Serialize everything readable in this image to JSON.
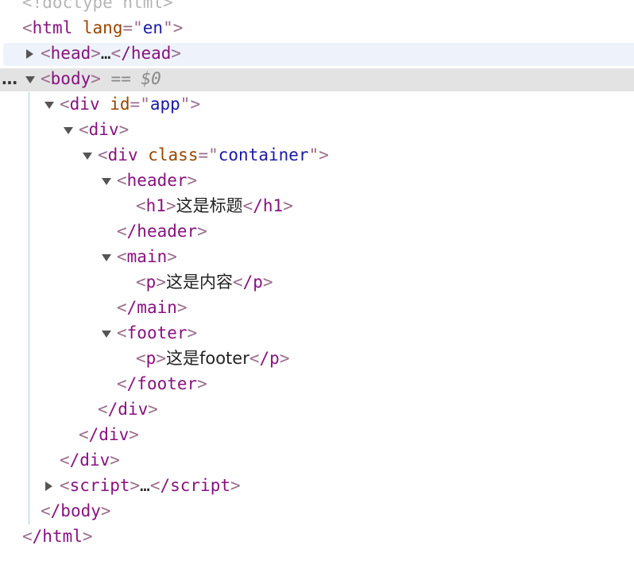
{
  "doctype_line": "<!doctype html>",
  "html_open": {
    "tag": "html",
    "attr_name": "lang",
    "attr_value": "en"
  },
  "head_collapsed": {
    "open": "head",
    "ellipsis": "…",
    "close": "/head"
  },
  "body_open": {
    "tag": "body",
    "selected_marker": "== $0",
    "row_menu": "…"
  },
  "div_app": {
    "tag": "div",
    "attr_name": "id",
    "attr_value": "app"
  },
  "div_plain": {
    "tag": "div"
  },
  "div_container": {
    "tag": "div",
    "attr_name": "class",
    "attr_value": "container"
  },
  "header": {
    "tag": "header",
    "child_tag": "h1",
    "child_text": "这是标题",
    "child_close": "/h1",
    "close": "/header"
  },
  "main": {
    "tag": "main",
    "child_tag": "p",
    "child_text": "这是内容",
    "child_close": "/p",
    "close": "/main"
  },
  "footer": {
    "tag": "footer",
    "child_tag": "p",
    "child_text": "这是footer",
    "child_close": "/p",
    "close": "/footer"
  },
  "closing_tags": {
    "div_container": "/div",
    "div_plain": "/div",
    "div_app": "/div",
    "body": "/body",
    "html": "/html"
  },
  "script_collapsed": {
    "open": "script",
    "ellipsis": "…",
    "close": "/script"
  }
}
